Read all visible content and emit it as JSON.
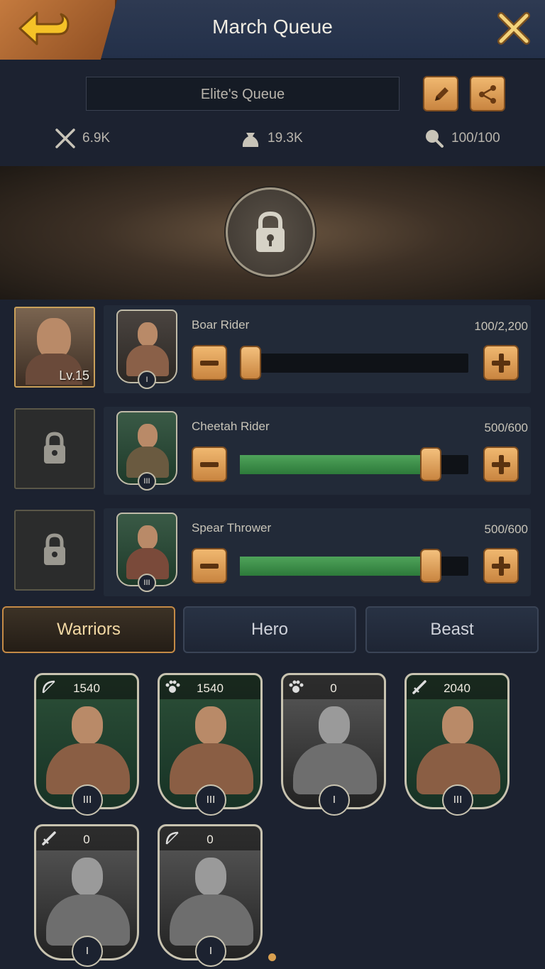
{
  "header": {
    "title": "March Queue"
  },
  "queue": {
    "name": "Elite's Queue"
  },
  "stats": {
    "power": "6.9K",
    "load": "19.3K",
    "food": "100/100"
  },
  "lineup": {
    "hero_level": "Lv.15",
    "rows": [
      {
        "troop": "Boar Rider",
        "count": "100/2,200",
        "tier": "I",
        "fill_fraction": 0.045
      },
      {
        "troop": "Cheetah Rider",
        "count": "500/600",
        "tier": "III",
        "fill_fraction": 0.833
      },
      {
        "troop": "Spear Thrower",
        "count": "500/600",
        "tier": "III",
        "fill_fraction": 0.833
      }
    ]
  },
  "tabs": [
    "Warriors",
    "Hero",
    "Beast"
  ],
  "active_tab": "Warriors",
  "cards": [
    {
      "count": "1540",
      "type_icon": "bow-icon",
      "tier": "III",
      "style": "green"
    },
    {
      "count": "1540",
      "type_icon": "paw-icon",
      "tier": "III",
      "style": "green"
    },
    {
      "count": "0",
      "type_icon": "paw-icon",
      "tier": "I",
      "style": "gray"
    },
    {
      "count": "2040",
      "type_icon": "sword-icon",
      "tier": "III",
      "style": "green"
    },
    {
      "count": "0",
      "type_icon": "sword-icon",
      "tier": "I",
      "style": "gray"
    },
    {
      "count": "0",
      "type_icon": "bow-icon",
      "tier": "I",
      "style": "gray"
    }
  ],
  "colors": {
    "accent": "#c98540",
    "slider_fill": "#2d7a3a",
    "background": "#1c2230"
  }
}
